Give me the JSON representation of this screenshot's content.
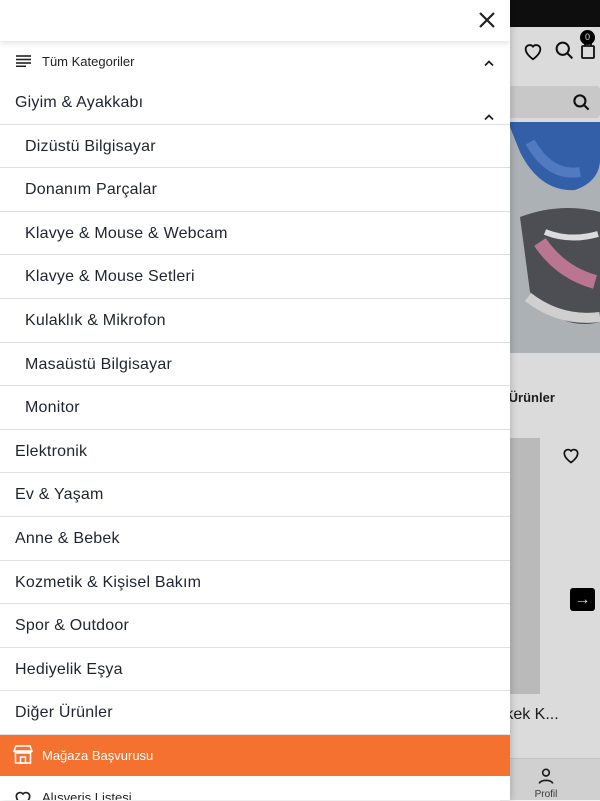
{
  "background": {
    "cart_count": "0",
    "tab_label": "r Ürünler",
    "product_title": "rkek K...",
    "profile_label": "Profil",
    "next_arrow": "→"
  },
  "drawer": {
    "all_categories_label": "Tüm Kategoriler",
    "categories": [
      {
        "label": "Giyim & Ayakkabı",
        "level": "top",
        "expanded": true
      },
      {
        "label": "Dizüstü Bilgisayar",
        "level": "sub"
      },
      {
        "label": "Donanım Parçalar",
        "level": "sub"
      },
      {
        "label": "Klavye & Mouse & Webcam",
        "level": "sub"
      },
      {
        "label": "Klavye & Mouse Setleri",
        "level": "sub"
      },
      {
        "label": "Kulaklık & Mikrofon",
        "level": "sub"
      },
      {
        "label": "Masaüstü Bilgisayar",
        "level": "sub"
      },
      {
        "label": "Monitor",
        "level": "sub"
      },
      {
        "label": "Elektronik",
        "level": "top"
      },
      {
        "label": "Ev & Yaşam",
        "level": "top"
      },
      {
        "label": "Anne & Bebek",
        "level": "top"
      },
      {
        "label": "Kozmetik & Kişisel Bakım",
        "level": "top"
      },
      {
        "label": "Spor & Outdoor",
        "level": "top"
      },
      {
        "label": "Hediyelik Eşya",
        "level": "top"
      },
      {
        "label": "Diğer Ürünler",
        "level": "top"
      }
    ],
    "store_apply_label": "Mağaza Başvurusu",
    "wishlist_label": "Alışveriş Listesi"
  },
  "colors": {
    "accent_orange": "#f47130",
    "text_dark": "#1f2430"
  },
  "icons": [
    "close-icon",
    "menu-lines-icon",
    "chevron-up-icon",
    "store-icon",
    "heart-icon",
    "search-icon",
    "cart-icon",
    "user-icon",
    "arrow-right-icon"
  ]
}
